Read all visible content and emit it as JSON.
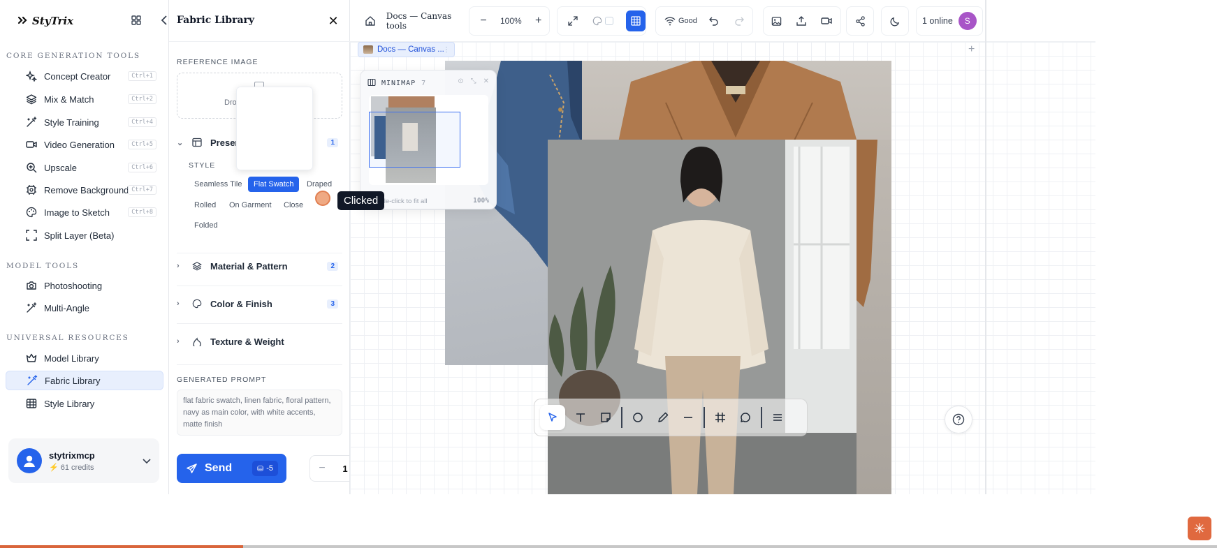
{
  "brand": {
    "name": "StyTrix"
  },
  "sidebar": {
    "sections": [
      {
        "title": "CORE GENERATION TOOLS",
        "items": [
          {
            "label": "Concept Creator",
            "shortcut": "Ctrl+1",
            "icon": "sparkles-icon"
          },
          {
            "label": "Mix & Match",
            "shortcut": "Ctrl+2",
            "icon": "layers-icon"
          },
          {
            "label": "Style Training",
            "shortcut": "Ctrl+4",
            "icon": "wand-icon"
          },
          {
            "label": "Video Generation",
            "shortcut": "Ctrl+5",
            "icon": "video-icon"
          },
          {
            "label": "Upscale",
            "shortcut": "Ctrl+6",
            "icon": "zoom-in-icon"
          },
          {
            "label": "Remove Background",
            "shortcut": "Ctrl+7",
            "icon": "scan-icon"
          },
          {
            "label": "Image to Sketch",
            "shortcut": "Ctrl+8",
            "icon": "palette-icon"
          },
          {
            "label": "Split Layer (Beta)",
            "shortcut": "",
            "icon": "crop-frame-icon"
          }
        ]
      },
      {
        "title": "MODEL TOOLS",
        "items": [
          {
            "label": "Photoshooting",
            "icon": "camera-icon"
          },
          {
            "label": "Multi-Angle",
            "icon": "wand-icon"
          }
        ]
      },
      {
        "title": "UNIVERSAL RESOURCES",
        "items": [
          {
            "label": "Model Library",
            "icon": "crown-icon"
          },
          {
            "label": "Fabric Library",
            "icon": "wand-icon",
            "active": true
          },
          {
            "label": "Style Library",
            "icon": "table-icon"
          }
        ]
      }
    ],
    "user": {
      "name": "stytrixmcp",
      "credits": "61 credits"
    }
  },
  "panel": {
    "title": "Fabric Library",
    "reference_label": "REFERENCE IMAGE",
    "dropzone_text": "Dro",
    "sections": [
      {
        "label": "Presenta",
        "count": "1",
        "expanded": true
      },
      {
        "label": "Material & Pattern",
        "count": "2"
      },
      {
        "label": "Color & Finish",
        "count": "3"
      },
      {
        "label": "Texture & Weight",
        "count": ""
      }
    ],
    "style_label": "STYLE",
    "style_chips": [
      "Seamless Tile",
      "Flat Swatch",
      "Draped",
      "Rolled",
      "On Garment",
      "Close",
      "Folded"
    ],
    "selected_chip": "Flat Swatch",
    "tooltip": "Clicked",
    "prompt_label": "GENERATED PROMPT",
    "prompt_text": "flat fabric swatch, linen fabric, floral pattern, navy as main color, with white accents, matte finish",
    "send_label": "Send",
    "send_cost": "-5",
    "quantity": "1",
    "minus": "−",
    "plus": "+"
  },
  "toolbar": {
    "doc_title": "Docs — Canvas tools",
    "zoom": "100%",
    "connection": "Good",
    "online": "1 online",
    "avatar_initial": "S"
  },
  "canvas": {
    "tab_label": "Docs — Canvas ...",
    "minimap": {
      "title": "MINIMAP",
      "count": "7",
      "footer": "Double-click to fit all",
      "zoom": "100%"
    }
  },
  "colors": {
    "accent": "#2563eb",
    "progress": "#d9653b",
    "avatar": "#a855c7"
  },
  "progress": {
    "fraction": 0.2
  }
}
